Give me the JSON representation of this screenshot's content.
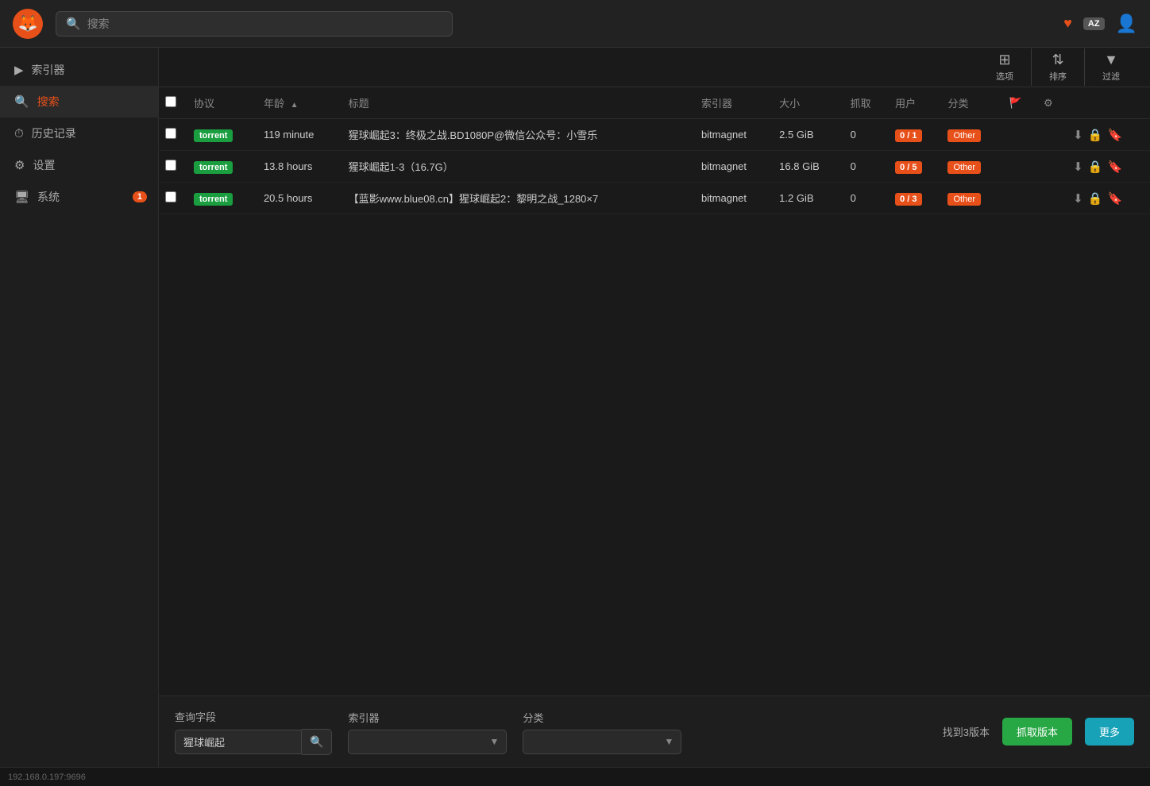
{
  "topbar": {
    "logo_emoji": "🦊",
    "search_placeholder": "搜索",
    "lang_badge": "AZ",
    "heart": "♥"
  },
  "sidebar": {
    "items": [
      {
        "id": "indexer",
        "icon": "▶",
        "label": "索引器",
        "active": false,
        "badge": null
      },
      {
        "id": "search",
        "icon": "🔍",
        "label": "搜索",
        "active": true,
        "badge": null
      },
      {
        "id": "history",
        "icon": "⏱",
        "label": "历史记录",
        "active": false,
        "badge": null
      },
      {
        "id": "settings",
        "icon": "⚙",
        "label": "设置",
        "active": false,
        "badge": null
      },
      {
        "id": "system",
        "icon": "🖥",
        "label": "系统",
        "active": false,
        "badge": "1"
      }
    ]
  },
  "toolbar": {
    "select_label": "选项",
    "sort_label": "排序",
    "filter_label": "过滤"
  },
  "table": {
    "columns": [
      {
        "id": "check",
        "label": ""
      },
      {
        "id": "protocol",
        "label": "协议"
      },
      {
        "id": "age",
        "label": "年龄",
        "sort": "asc"
      },
      {
        "id": "title",
        "label": "标题"
      },
      {
        "id": "indexer",
        "label": "索引器"
      },
      {
        "id": "size",
        "label": "大小"
      },
      {
        "id": "grabs",
        "label": "抓取"
      },
      {
        "id": "peers",
        "label": "用户"
      },
      {
        "id": "category",
        "label": "分类"
      },
      {
        "id": "flag",
        "label": "🚩"
      },
      {
        "id": "settings",
        "label": "⚙"
      },
      {
        "id": "actions",
        "label": ""
      }
    ],
    "rows": [
      {
        "protocol": "torrent",
        "age": "119 minute",
        "title": "猩球崛起3：终极之战.BD1080P@微信公众号：小雪乐",
        "indexer": "bitmagnet",
        "size": "2.5 GiB",
        "grabs": "0",
        "peers": "0 / 1",
        "peers_color": "#e8501a",
        "category": "Other",
        "category_color": "#e8501a"
      },
      {
        "protocol": "torrent",
        "age": "13.8 hours",
        "title": "猩球崛起1-3（16.7G）",
        "indexer": "bitmagnet",
        "size": "16.8 GiB",
        "grabs": "0",
        "peers": "0 / 5",
        "peers_color": "#e8501a",
        "category": "Other",
        "category_color": "#e8501a"
      },
      {
        "protocol": "torrent",
        "age": "20.5 hours",
        "title": "【蓝影www.blue08.cn】猩球崛起2：黎明之战_1280×7",
        "indexer": "bitmagnet",
        "size": "1.2 GiB",
        "grabs": "0",
        "peers": "0 / 3",
        "peers_color": "#e8501a",
        "category": "Other",
        "category_color": "#e8501a"
      }
    ]
  },
  "bottom": {
    "query_label": "查询字段",
    "query_value": "猩球崛起",
    "indexer_label": "索引器",
    "indexer_placeholder": "",
    "category_label": "分类",
    "category_placeholder": "",
    "found_text": "找到3版本",
    "capture_btn": "抓取版本",
    "more_btn": "更多"
  },
  "statusbar": {
    "ip": "192.168.0.197:9696"
  }
}
